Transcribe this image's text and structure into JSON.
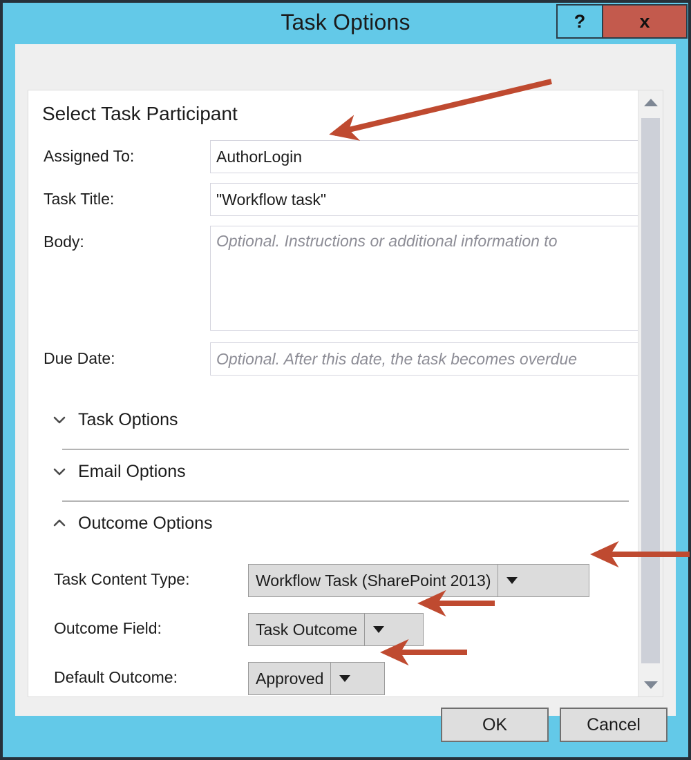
{
  "window": {
    "title": "Task Options",
    "help_label": "?",
    "close_label": "x",
    "accent_color": "#63c9e8",
    "close_color": "#c35a4d",
    "annotation_color": "#bf4a30"
  },
  "content": {
    "heading": "Select Task Participant",
    "fields": [
      {
        "label": "Assigned To:",
        "value": "AuthorLogin",
        "placeholder": "",
        "is_placeholder": false
      },
      {
        "label": "Task Title:",
        "value": "\"Workflow task\"",
        "placeholder": "",
        "is_placeholder": false
      },
      {
        "label": "Body:",
        "value": "Optional. Instructions or additional information to",
        "placeholder": "Optional. Instructions or additional information to",
        "is_placeholder": true
      },
      {
        "label": "Due Date:",
        "value": "Optional. After this date, the task becomes overdue",
        "placeholder": "Optional. After this date, the task becomes overdue",
        "is_placeholder": true
      }
    ],
    "sections": [
      {
        "label": "Task Options",
        "expanded": false,
        "chevron": "chevron-down-icon"
      },
      {
        "label": "Email Options",
        "expanded": false,
        "chevron": "chevron-down-icon"
      },
      {
        "label": "Outcome Options",
        "expanded": true,
        "chevron": "chevron-up-icon"
      }
    ],
    "outcome_options": [
      {
        "label": "Task Content Type:",
        "value": "Workflow Task (SharePoint 2013)"
      },
      {
        "label": "Outcome Field:",
        "value": "Task Outcome"
      },
      {
        "label": "Default Outcome:",
        "value": "Approved"
      }
    ]
  },
  "footer": {
    "ok_label": "OK",
    "cancel_label": "Cancel"
  },
  "scrollbar": {
    "up_icon": "triangle-up-icon",
    "down_icon": "triangle-down-icon"
  }
}
